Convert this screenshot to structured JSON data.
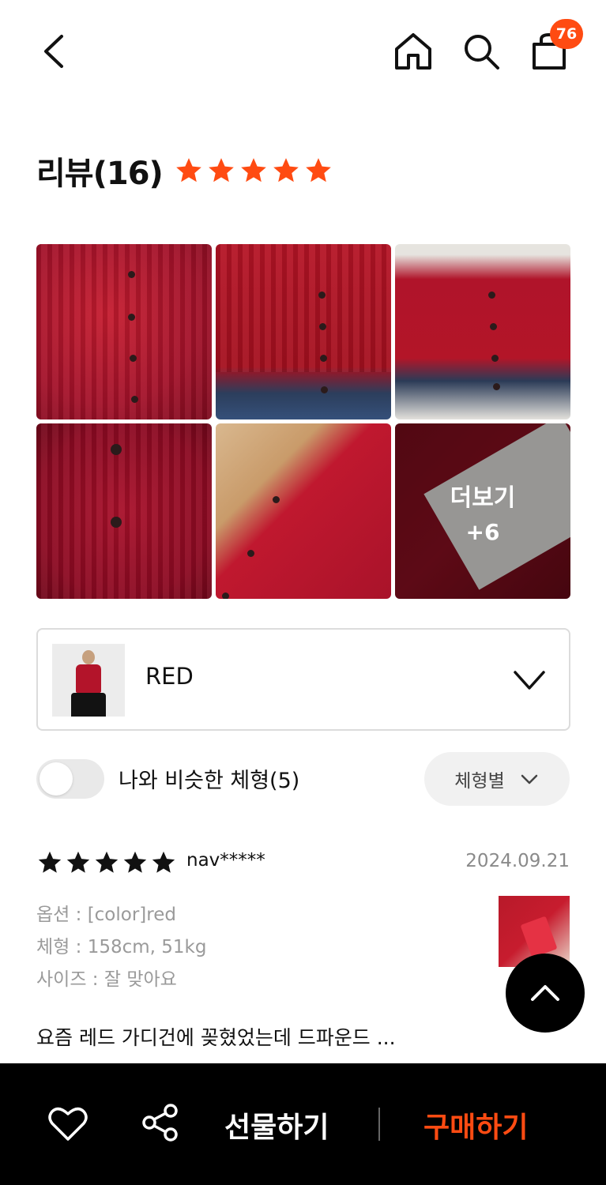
{
  "header": {
    "cart_count": "76",
    "icons": [
      "chevron-left-icon",
      "home-icon",
      "search-icon",
      "shopping-bag-icon"
    ]
  },
  "reviews": {
    "title": "리뷰(16)",
    "rating_stars": 5,
    "star_color": "#ff4b12"
  },
  "photos": {
    "more_label": "더보기",
    "more_count": "+6"
  },
  "option": {
    "label": "RED"
  },
  "filters": {
    "similar_body_label": "나와 비슷한 체형(5)",
    "similar_body_on": false,
    "body_type_label": "체형별"
  },
  "review_item": {
    "stars": 5,
    "user": "nav*****",
    "date": "2024.09.21",
    "option_line": "옵션 : [color]red",
    "body_line": "체형 : 158cm, 51kg",
    "size_line": "사이즈 : 잘 맞아요",
    "text": "요즘 레드 가디건에 꽂혔었는데 드파운드 ..."
  },
  "bottom_bar": {
    "gift_label": "선물하기",
    "buy_label": "구매하기",
    "accent_color": "#ff4b12"
  }
}
